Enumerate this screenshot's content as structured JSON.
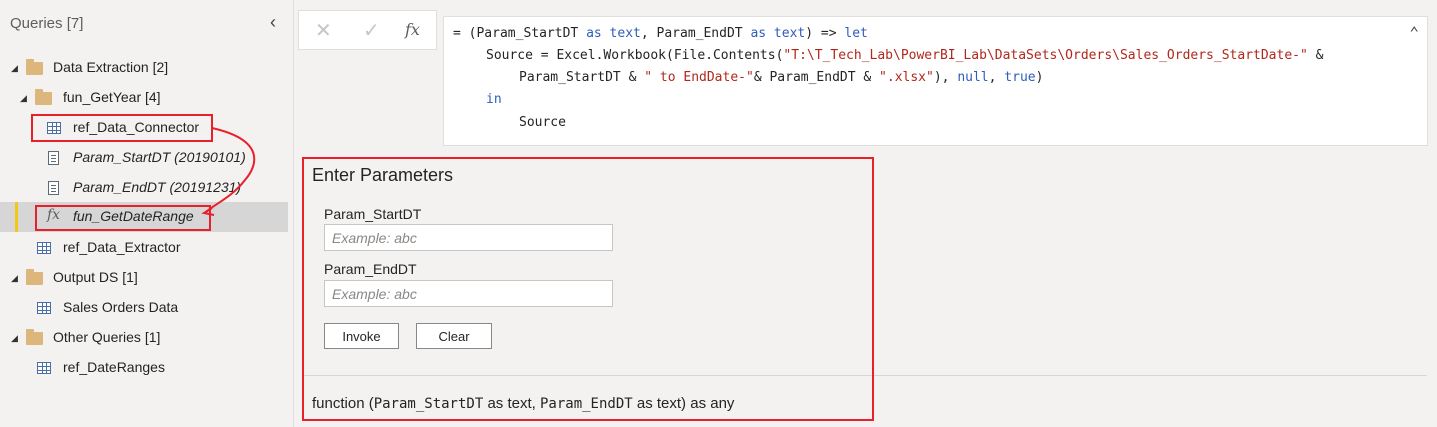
{
  "queries_panel": {
    "title": "Queries [7]",
    "tree": [
      {
        "type": "group",
        "label": "Data Extraction [2]"
      },
      {
        "type": "group",
        "label": "fun_GetYear [4]"
      },
      {
        "type": "table",
        "label": "ref_Data_Connector"
      },
      {
        "type": "parameter",
        "label": "Param_StartDT (20190101)"
      },
      {
        "type": "parameter",
        "label": "Param_EndDT (20191231)"
      },
      {
        "type": "function",
        "label": "fun_GetDateRange",
        "selected": true
      },
      {
        "type": "table",
        "label": "ref_Data_Extractor"
      },
      {
        "type": "group",
        "label": "Output DS [1]"
      },
      {
        "type": "table",
        "label": "Sales Orders Data"
      },
      {
        "type": "group",
        "label": "Other Queries [1]"
      },
      {
        "type": "table",
        "label": "ref_DateRanges"
      }
    ]
  },
  "formula_bar": {
    "cancel_icon": "close-icon",
    "commit_icon": "check-icon",
    "fx_label": "fx",
    "line1_a": "= (Param_StartDT ",
    "line1_kw1": "as text",
    "line1_b": ", Param_EndDT ",
    "line1_kw2": "as text",
    "line1_c": ") => ",
    "line1_kw3": "let",
    "line2_a": "Source = Excel.Workbook(File.Contents(",
    "line2_str": "\"T:\\T_Tech_Lab\\PowerBI_Lab\\DataSets\\Orders\\Sales_Orders_StartDate-\"",
    "line2_b": " &",
    "line3_a": "Param_StartDT & ",
    "line3_str1": "\" to EndDate-\"",
    "line3_b": "& Param_EndDT & ",
    "line3_str2": "\".xlsx\"",
    "line3_c": "), ",
    "line3_kw1": "null",
    "line3_d": ", ",
    "line3_kw2": "true",
    "line3_e": ")",
    "line4_kw": "in",
    "line5": "Source"
  },
  "parameters_panel": {
    "title": "Enter Parameters",
    "start_label": "Param_StartDT",
    "start_placeholder": "Example: abc",
    "end_label": "Param_EndDT",
    "end_placeholder": "Example: abc",
    "invoke_label": "Invoke",
    "clear_label": "Clear",
    "signature_prefix": "function (",
    "signature_p1": "Param_StartDT",
    "signature_mid": " as text, ",
    "signature_p2": "Param_EndDT",
    "signature_suffix": " as text) as any"
  },
  "colors": {
    "highlight_box": "#e8202a",
    "selected_accent": "#f2c811",
    "keyword": "#2f5dbb",
    "string": "#b0281c"
  }
}
